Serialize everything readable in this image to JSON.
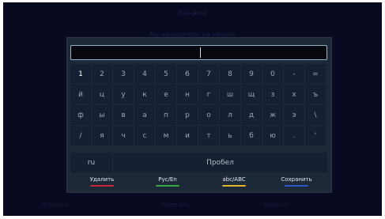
{
  "background": {
    "title": "Каналы",
    "subtitle": "Вы находитесь на канале",
    "footer_left": "Добавить",
    "footer_mid": "Изменить",
    "footer_right": "Удалить"
  },
  "keyboard": {
    "input_value": "",
    "rows": [
      [
        "1",
        "2",
        "3",
        "4",
        "5",
        "6",
        "7",
        "8",
        "9",
        "0",
        "-",
        "="
      ],
      [
        "й",
        "ц",
        "у",
        "к",
        "е",
        "н",
        "г",
        "ш",
        "щ",
        "з",
        "х",
        "ъ"
      ],
      [
        "ф",
        "ы",
        "в",
        "а",
        "п",
        "р",
        "о",
        "л",
        "д",
        "ж",
        "э",
        "\\"
      ],
      [
        "/",
        "я",
        "ч",
        "с",
        "м",
        "и",
        "т",
        "ь",
        "б",
        "ю",
        ".",
        "'"
      ]
    ],
    "selected_key": "1",
    "lang_key": "ru",
    "space_key": "Пробел"
  },
  "functions": [
    {
      "label": "Удалить",
      "color": "#c8283a"
    },
    {
      "label": "Рус/En",
      "color": "#3aa83c"
    },
    {
      "label": "abc/ABC",
      "color": "#e0b62a"
    },
    {
      "label": "Сохранить",
      "color": "#2b58c6"
    }
  ]
}
